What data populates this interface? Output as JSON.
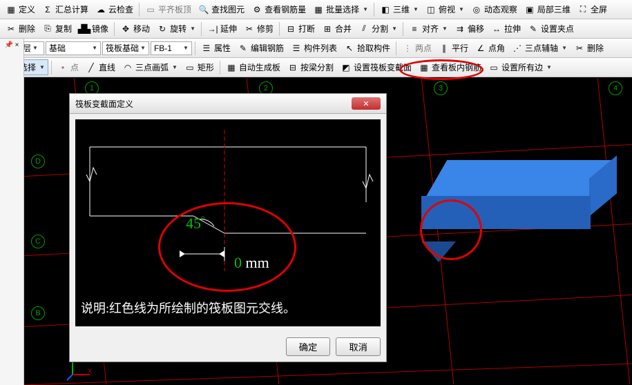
{
  "toolbar1": {
    "define": "定义",
    "sumcalc": "汇总计算",
    "cloudcheck": "云检查",
    "flattop": "平齐板顶",
    "findelem": "查找图元",
    "viewrebar": "查看钢筋量",
    "batchsel": "批量选择",
    "threeD": "三维",
    "persp": "俯视",
    "dynview": "动态观察",
    "local3d": "局部三维",
    "fullscreen": "全屏"
  },
  "toolbar2": {
    "delete": "删除",
    "copy": "复制",
    "mirror": "镜像",
    "move": "移动",
    "rotate": "旋转",
    "extend": "延伸",
    "trim": "修剪",
    "break": "打断",
    "merge": "合并",
    "split": "分割",
    "align": "对齐",
    "offset": "偏移",
    "stretch": "拉伸",
    "setclamp": "设置夹点"
  },
  "toolbar3": {
    "floor": "基础层",
    "category": "基础",
    "type": "筏板基础",
    "name": "FB-1",
    "prop": "属性",
    "editrebar": "编辑钢筋",
    "complist": "构件列表",
    "pickcomp": "拾取构件",
    "twopt": "两点",
    "parallel": "平行",
    "ptangle": "点角",
    "threeptaux": "三点辅轴",
    "delaux": "删除"
  },
  "toolbar4": {
    "select": "选择",
    "point": "点",
    "line": "直线",
    "arc3pt": "三点画弧",
    "rect": "矩形",
    "autoslab": "自动生成板",
    "beamsplit": "按梁分割",
    "setsection": "设置筏板变截面",
    "viewslabrebar": "查看板内钢筋",
    "setalledge": "设置所有边"
  },
  "dialog": {
    "title": "筏板变截面定义",
    "angle": "45",
    "degree": "°",
    "offset": "0",
    "unit": "mm",
    "desc": "说明:红色线为所绘制的筏板图元交线。",
    "ok": "确定",
    "cancel": "取消"
  },
  "grid": {
    "cols": [
      "1",
      "2",
      "3",
      "4"
    ],
    "rows": [
      "D",
      "C",
      "B"
    ]
  }
}
